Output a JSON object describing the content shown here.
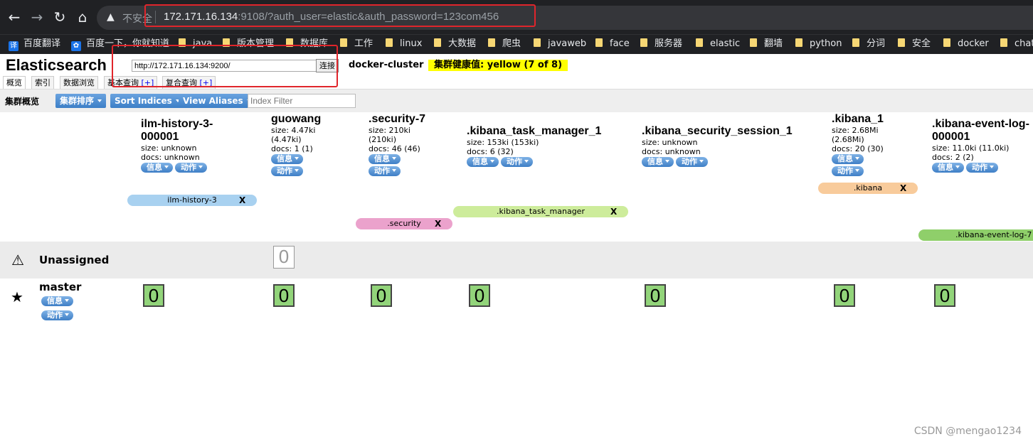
{
  "browser": {
    "insecure_label": "不安全",
    "url_host": "172.171.16.134",
    "url_rest": ":9108/?auth_user=elastic&auth_password=123com456",
    "bookmarks": [
      "百度翻译",
      "百度一下，你就知道",
      "java",
      "版本管理",
      "数据库",
      "工作",
      "linux",
      "大数据",
      "爬虫",
      "javaweb",
      "face",
      "服务器",
      "elastic",
      "翻墙",
      "python",
      "分词",
      "安全",
      "docker",
      "chat"
    ]
  },
  "header": {
    "title": "Elasticsearch",
    "url_value": "http://172.171.16.134:9200/",
    "connect_label": "连接",
    "cluster_name": "docker-cluster",
    "health_label": "集群健康值: yellow (7 of 8)",
    "health_color": "#ffff00"
  },
  "tabs": [
    {
      "label": "概览",
      "plus": ""
    },
    {
      "label": "索引",
      "plus": ""
    },
    {
      "label": "数据浏览",
      "plus": ""
    },
    {
      "label": "基本查询",
      "plus": "[+]"
    },
    {
      "label": "复合查询",
      "plus": "[+]"
    }
  ],
  "toolbar": {
    "title": "集群概览",
    "sort_cluster": "集群排序",
    "sort_indices": "Sort Indices",
    "view_aliases": "View Aliases",
    "index_filter_placeholder": "Index Filter"
  },
  "pill_labels": {
    "info": "信息",
    "action": "动作"
  },
  "indices": [
    {
      "name1": "ilm-history-3-",
      "name2": "000001",
      "line1": "size: unknown",
      "line2": "docs: unknown",
      "line3": "",
      "line4": ""
    },
    {
      "name1": "guowang",
      "name2": "",
      "line1": "size: 4.47ki",
      "line2": "(4.47ki)",
      "line3": "docs: 1 (1)",
      "line4": ""
    },
    {
      "name1": ".security-7",
      "name2": "",
      "line1": "size: 210ki",
      "line2": "(210ki)",
      "line3": "docs: 46 (46)",
      "line4": ""
    },
    {
      "name1": ".kibana_task_manager_1",
      "name2": "",
      "line1": "size: 153ki (153ki)",
      "line2": "docs: 6 (32)",
      "line3": "",
      "line4": ""
    },
    {
      "name1": ".kibana_security_session_1",
      "name2": "",
      "line1": "size: unknown",
      "line2": "docs: unknown",
      "line3": "",
      "line4": ""
    },
    {
      "name1": ".kibana_1",
      "name2": "",
      "line1": "size: 2.68Mi",
      "line2": "(2.68Mi)",
      "line3": "docs: 20 (30)",
      "line4": ""
    },
    {
      "name1": ".kibana-event-log-",
      "name2": "000001",
      "line1": "size: 11.0ki (11.0ki)",
      "line2": "docs: 2 (2)",
      "line3": "",
      "line4": ""
    }
  ],
  "aliases": [
    {
      "label": "ilm-history-3",
      "color": "#a8d1f0"
    },
    {
      "label": ".security",
      "color": "#eba2cc"
    },
    {
      "label": ".kibana_task_manager",
      "color": "#cdec9b"
    },
    {
      "label": ".kibana",
      "color": "#f8cb9b"
    },
    {
      "label": ".kibana-event-log-7",
      "color": "#8fcf6a"
    }
  ],
  "alias_close": "X",
  "unassigned": {
    "label": "Unassigned",
    "shard": "0"
  },
  "master": {
    "label": "master",
    "shards": [
      "0",
      "0",
      "0",
      "0",
      "0",
      "0",
      "0"
    ],
    "shard_color": "#92d47a"
  },
  "watermark": "CSDN @mengao1234"
}
